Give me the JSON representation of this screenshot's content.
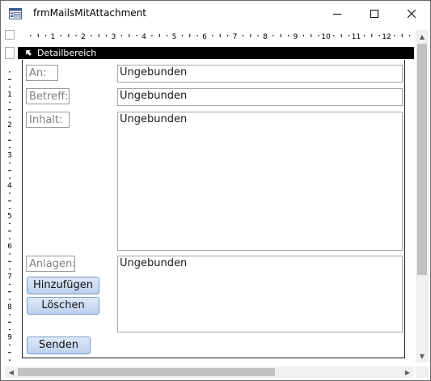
{
  "window": {
    "title": "frmMailsMitAttachment"
  },
  "section": {
    "label": "Detailbereich"
  },
  "form": {
    "labels": {
      "an": "An:",
      "betreff": "Betreff:",
      "inhalt": "Inhalt:",
      "anlagen": "Anlagen:"
    },
    "fields": {
      "an": "Ungebunden",
      "betreff": "Ungebunden",
      "inhalt": "Ungebunden",
      "anlagen": "Ungebunden"
    },
    "buttons": {
      "hinzufuegen": "Hinzufügen",
      "loeschen": "Löschen",
      "senden": "Senden"
    }
  },
  "ruler": {
    "h_labels": [
      "1",
      "2",
      "3",
      "4",
      "5",
      "6",
      "7",
      "8",
      "9",
      "10",
      "11",
      "12"
    ],
    "v_labels": [
      "1",
      "2",
      "3",
      "4",
      "5",
      "6",
      "7",
      "8",
      "9"
    ]
  },
  "icons": {
    "app": "form-icon",
    "minimize": "minimize-icon",
    "maximize": "maximize-icon",
    "close": "close-icon",
    "section": "section-arrow-icon"
  }
}
